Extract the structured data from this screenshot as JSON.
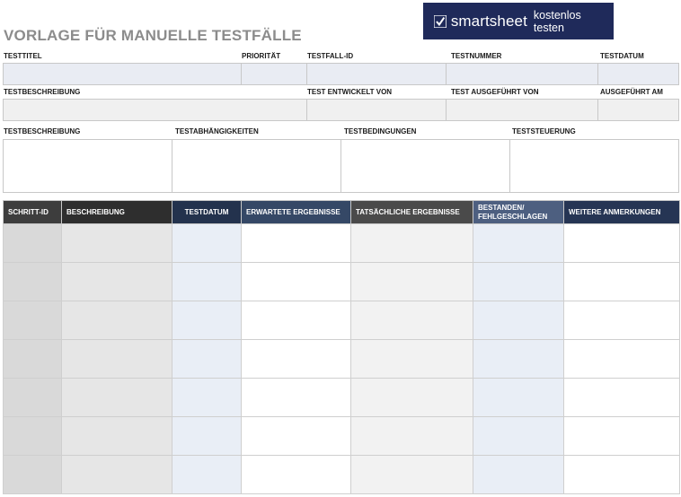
{
  "title": "VORLAGE FÜR MANUELLE TESTFÄLLE",
  "banner": {
    "brand": "smartsheet",
    "tagline": "kostenlos testen",
    "icon": "check-icon",
    "bg": "#1f2a5a"
  },
  "row1": {
    "labels": [
      "TESTTITEL",
      "PRIORITÄT",
      "TESTFALL-ID",
      "TESTNUMMER",
      "TESTDATUM"
    ]
  },
  "row2": {
    "labels": [
      "TESTBESCHREIBUNG",
      "TEST ENTWICKELT VON",
      "TEST AUSGEFÜHRT VON",
      "AUSGEFÜHRT AM"
    ]
  },
  "row3": {
    "labels": [
      "TESTBESCHREIBUNG",
      "TESTABHÄNGIGKEITEN",
      "TESTBEDINGUNGEN",
      "TESTSTEUERUNG"
    ]
  },
  "steps": {
    "headers": [
      "SCHRITT-ID",
      "BESCHREIBUNG",
      "TESTDATUM",
      "ERWARTETE ERGEBNISSE",
      "TATSÄCHLICHE ERGEBNISSE",
      "BESTANDEN/\nFEHLGESCHLAGEN",
      "WEITERE ANMERKUNGEN"
    ],
    "row_count": 7
  }
}
